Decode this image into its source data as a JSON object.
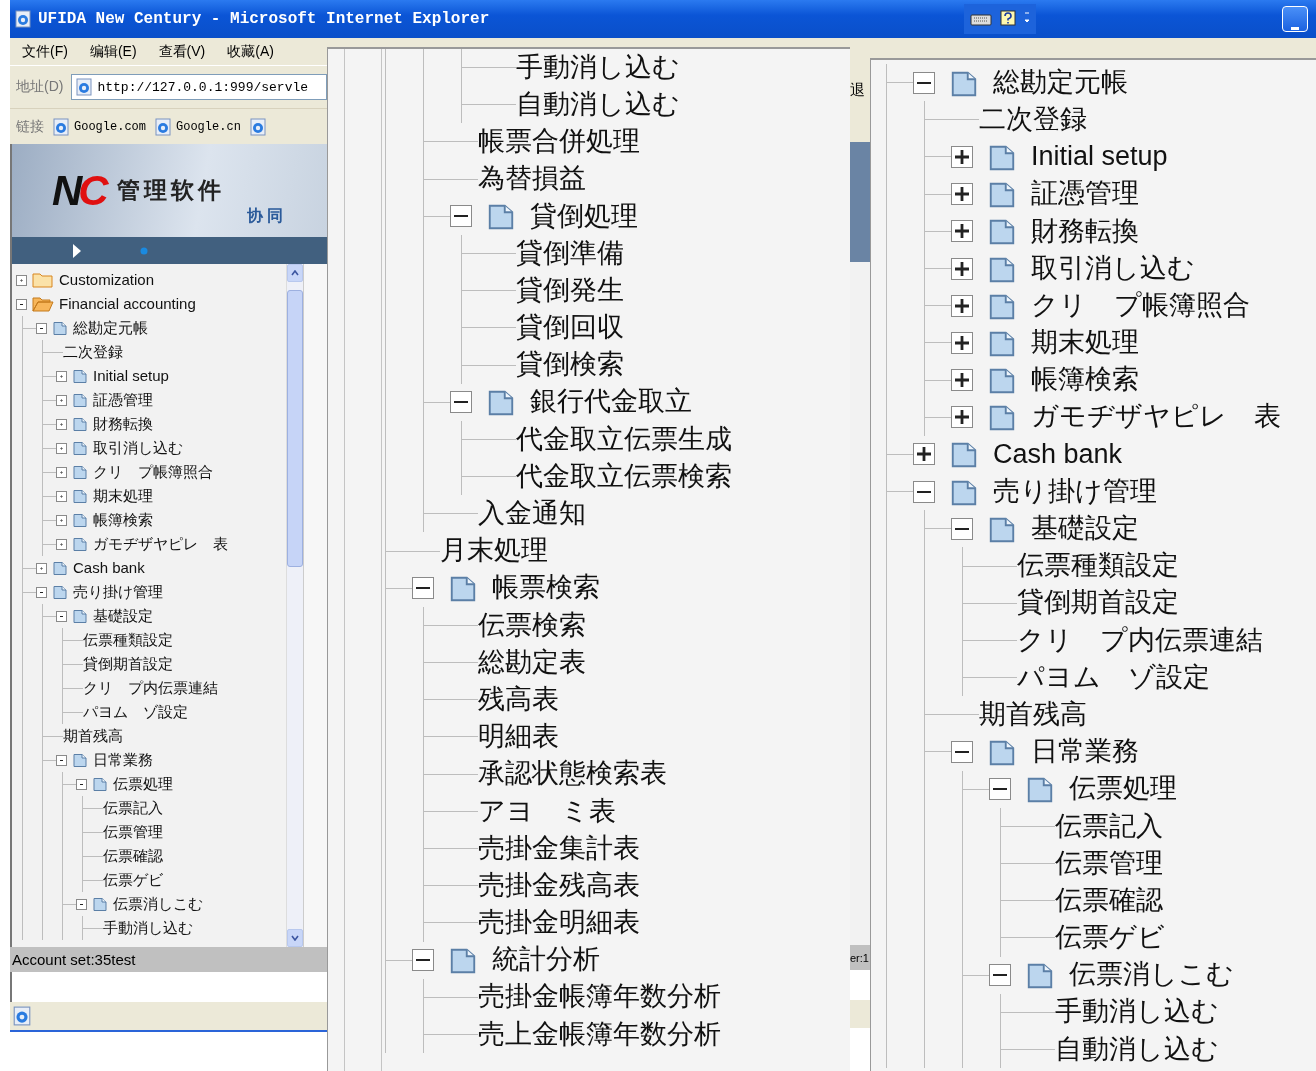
{
  "window": {
    "title": "UFIDA New Century - Microsoft Internet Explorer"
  },
  "menu_bar": [
    "文件(F)",
    "编辑(E)",
    "查看(V)",
    "收藏(A)"
  ],
  "address_bar": {
    "label": "地址(D)",
    "value": "http://127.0.0.1:999/servle"
  },
  "links_bar": {
    "label": "链接",
    "links": [
      "Google.com",
      "Google.cn"
    ]
  },
  "banner": {
    "logo_letters": [
      "N",
      "C"
    ],
    "product": "管理软件",
    "tagline": "协 同"
  },
  "nav_tree": [
    {
      "label": "Customization",
      "kind": "folder",
      "expanded": false
    },
    {
      "label": "Financial accounting",
      "kind": "folder",
      "expanded": true,
      "children": [
        {
          "label": "総勘定元帳",
          "kind": "page",
          "expanded": true,
          "children": [
            {
              "label": "二次登録"
            },
            {
              "label": "Initial setup",
              "kind": "page",
              "expanded": false
            },
            {
              "label": "証憑管理",
              "kind": "page",
              "expanded": false
            },
            {
              "label": "財務転換",
              "kind": "page",
              "expanded": false
            },
            {
              "label": "取引消し込む",
              "kind": "page",
              "expanded": false
            },
            {
              "label": "クリ　プ帳簿照合",
              "kind": "page",
              "expanded": false
            },
            {
              "label": "期末処理",
              "kind": "page",
              "expanded": false
            },
            {
              "label": "帳簿検索",
              "kind": "page",
              "expanded": false
            },
            {
              "label": "ガモヂザヤピレ　表",
              "kind": "page",
              "expanded": false
            }
          ]
        },
        {
          "label": "Cash bank",
          "kind": "page",
          "expanded": false
        },
        {
          "label": "売り掛け管理",
          "kind": "page",
          "expanded": true,
          "children": [
            {
              "label": "基礎設定",
              "kind": "page",
              "expanded": true,
              "children": [
                {
                  "label": "伝票種類設定"
                },
                {
                  "label": "貸倒期首設定"
                },
                {
                  "label": "クリ　プ内伝票連結"
                },
                {
                  "label": "パヨム　ゾ設定"
                }
              ]
            },
            {
              "label": "期首残高"
            },
            {
              "label": "日常業務",
              "kind": "page",
              "expanded": true,
              "children": [
                {
                  "label": "伝票処理",
                  "kind": "page",
                  "expanded": true,
                  "children": [
                    {
                      "label": "伝票記入"
                    },
                    {
                      "label": "伝票管理"
                    },
                    {
                      "label": "伝票確認"
                    },
                    {
                      "label": "伝票ゲビ"
                    }
                  ]
                },
                {
                  "label": "伝票消しこむ",
                  "kind": "page",
                  "expanded": true,
                  "children": [
                    {
                      "label": "手動消し込む"
                    }
                  ]
                }
              ]
            }
          ]
        }
      ]
    }
  ],
  "account_status": "Account set:35test",
  "side_strip": {
    "button_fragment": "退",
    "status_fragment": "er:1"
  },
  "zoom_middle": [
    {
      "children": [
        {
          "children": [
            {
              "label": "手動消し込む"
            },
            {
              "label": "自動消し込む"
            }
          ]
        },
        {
          "label": "帳票合併処理"
        },
        {
          "label": "為替損益"
        },
        {
          "label": "貸倒処理",
          "kind": "page",
          "expanded": true,
          "children": [
            {
              "label": "貸倒準備"
            },
            {
              "label": "貸倒発生"
            },
            {
              "label": "貸倒回収"
            },
            {
              "label": "貸倒検索"
            }
          ]
        },
        {
          "label": "銀行代金取立",
          "kind": "page",
          "expanded": true,
          "children": [
            {
              "label": "代金取立伝票生成"
            },
            {
              "label": "代金取立伝票検索"
            }
          ]
        },
        {
          "label": "入金通知"
        }
      ]
    },
    {
      "label": "月末処理"
    },
    {
      "label": "帳票検索",
      "kind": "page",
      "expanded": true,
      "children": [
        {
          "label": "伝票検索"
        },
        {
          "label": "総勘定表"
        },
        {
          "label": "残高表"
        },
        {
          "label": "明細表"
        },
        {
          "label": "承認状態検索表"
        },
        {
          "label": "アヨ　ミ表"
        },
        {
          "label": "売掛金集計表"
        },
        {
          "label": "売掛金残高表"
        },
        {
          "label": "売掛金明細表"
        }
      ]
    },
    {
      "label": "統計分析",
      "kind": "page",
      "expanded": true,
      "children": [
        {
          "label": "売掛金帳簿年数分析"
        },
        {
          "label": "売上金帳簿年数分析"
        }
      ]
    }
  ],
  "zoom_right": [
    {
      "label": "総勘定元帳",
      "kind": "page",
      "expanded": true,
      "children": [
        {
          "label": "二次登録"
        },
        {
          "label": "Initial setup",
          "kind": "page",
          "expanded": false
        },
        {
          "label": "証憑管理",
          "kind": "page",
          "expanded": false
        },
        {
          "label": "財務転換",
          "kind": "page",
          "expanded": false
        },
        {
          "label": "取引消し込む",
          "kind": "page",
          "expanded": false
        },
        {
          "label": "クリ　プ帳簿照合",
          "kind": "page",
          "expanded": false
        },
        {
          "label": "期末処理",
          "kind": "page",
          "expanded": false
        },
        {
          "label": "帳簿検索",
          "kind": "page",
          "expanded": false
        },
        {
          "label": "ガモヂザヤピレ　表",
          "kind": "page",
          "expanded": false
        }
      ]
    },
    {
      "label": "Cash bank",
      "kind": "page",
      "expanded": false
    },
    {
      "label": "売り掛け管理",
      "kind": "page",
      "expanded": true,
      "children": [
        {
          "label": "基礎設定",
          "kind": "page",
          "expanded": true,
          "children": [
            {
              "label": "伝票種類設定"
            },
            {
              "label": "貸倒期首設定"
            },
            {
              "label": "クリ　プ内伝票連結"
            },
            {
              "label": "パヨム　ゾ設定"
            }
          ]
        },
        {
          "label": "期首残高"
        },
        {
          "label": "日常業務",
          "kind": "page",
          "expanded": true,
          "children": [
            {
              "label": "伝票処理",
              "kind": "page",
              "expanded": true,
              "children": [
                {
                  "label": "伝票記入"
                },
                {
                  "label": "伝票管理"
                },
                {
                  "label": "伝票確認"
                },
                {
                  "label": "伝票ゲビ"
                }
              ]
            },
            {
              "label": "伝票消しこむ",
              "kind": "page",
              "expanded": true,
              "children": [
                {
                  "label": "手動消し込む"
                },
                {
                  "label": "自動消し込む"
                }
              ]
            }
          ]
        }
      ]
    }
  ]
}
